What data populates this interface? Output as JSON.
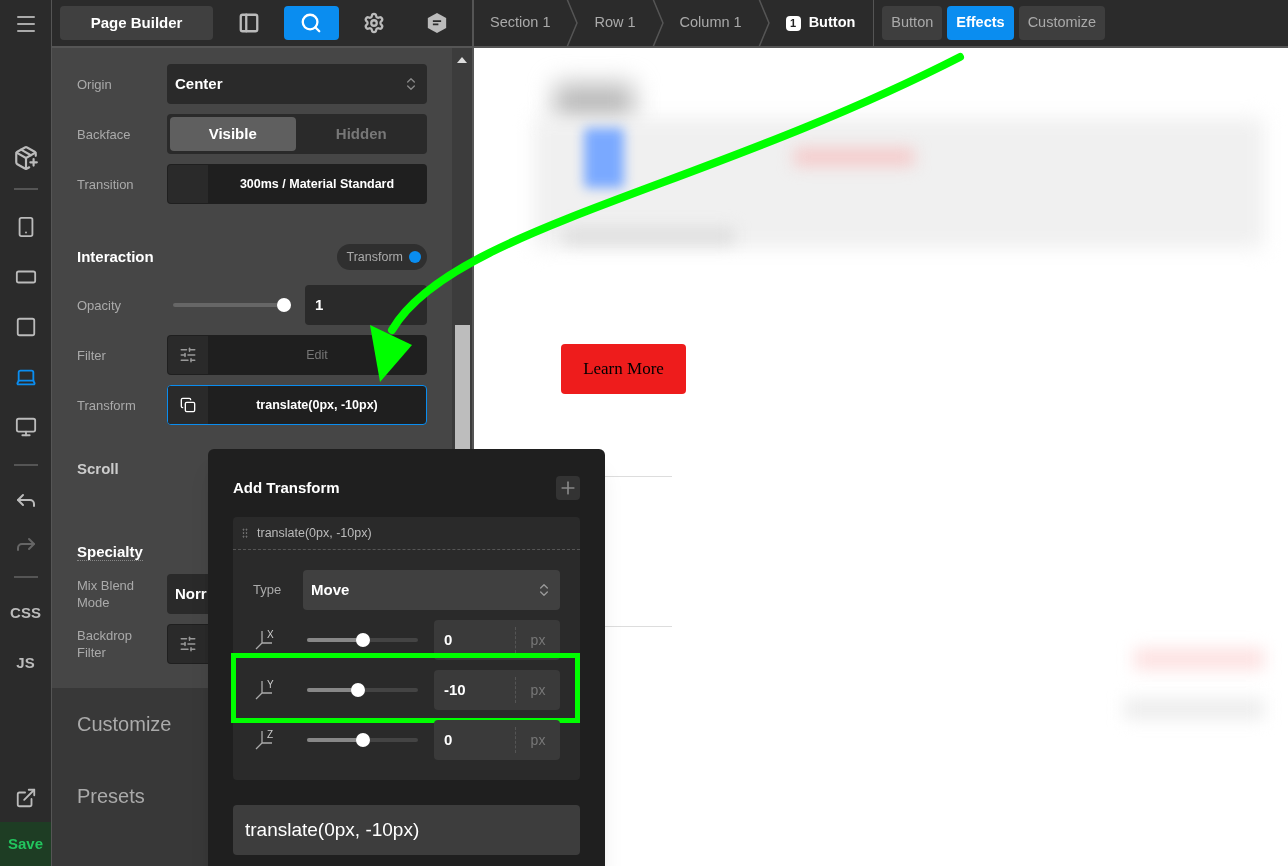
{
  "rail": {
    "devices": [
      {
        "selected": false
      },
      {
        "selected": false
      },
      {
        "selected": false
      },
      {
        "selected": true
      },
      {
        "selected": false
      }
    ],
    "code_buttons": [
      "CSS",
      "JS"
    ],
    "save": "Save"
  },
  "header": {
    "title": "Page Builder",
    "tools": [
      {
        "selected": false
      },
      {
        "selected": true
      },
      {
        "selected": false
      },
      {
        "selected": false
      }
    ]
  },
  "breadcrumbs": [
    {
      "label": "Section 1",
      "current": false
    },
    {
      "label": "Row 1",
      "current": false
    },
    {
      "label": "Column 1",
      "current": false
    },
    {
      "label": "Button",
      "badge": "1",
      "current": true
    }
  ],
  "tabs": [
    {
      "label": "Button",
      "selected": false
    },
    {
      "label": "Effects",
      "selected": true
    },
    {
      "label": "Customize",
      "selected": false
    }
  ],
  "panel": {
    "rows": [
      {
        "kind": "select",
        "label": "Origin",
        "value": "Center"
      },
      {
        "kind": "segmented",
        "label": "Backface",
        "options": [
          {
            "label": "Visible",
            "selected": true
          },
          {
            "label": "Hidden",
            "selected": false
          }
        ]
      },
      {
        "kind": "transition",
        "label": "Transition",
        "value": "300ms / Material Standard",
        "set": true,
        "focused": false
      }
    ],
    "interaction": {
      "title": "Interaction",
      "toggle": {
        "label": "Transform",
        "on": true
      },
      "rows": [
        {
          "kind": "slider",
          "label": "Opacity",
          "level": 1,
          "value": "1"
        },
        {
          "kind": "filter",
          "label": "Filter",
          "placeholder": "Edit",
          "focused": false
        },
        {
          "kind": "transform",
          "label": "Transform",
          "value": "translate(0px, -10px)",
          "set": true,
          "focused": true
        }
      ]
    },
    "scroll": {
      "title": "Scroll"
    },
    "specialty": {
      "title": "Specialty",
      "rows": [
        {
          "kind": "select",
          "label": "Mix Blend Mode",
          "value": "Norr"
        },
        {
          "kind": "filter",
          "label": "Backdrop Filter",
          "focused": false
        }
      ]
    },
    "sections": [
      "Customize",
      "Presets"
    ]
  },
  "popover": {
    "title": "Add Transform",
    "item": {
      "label": "translate(0px, -10px)",
      "type_label": "Type",
      "type_value": "Move",
      "axes": [
        {
          "axis": "X",
          "level": 0.5,
          "value": "0",
          "unit": "px",
          "highlighted": false
        },
        {
          "axis": "Y",
          "level": 0.45,
          "value": "-10",
          "unit": "px",
          "highlighted": true
        },
        {
          "axis": "Z",
          "level": 0.5,
          "value": "0",
          "unit": "px",
          "highlighted": false
        }
      ]
    },
    "output": "translate(0px, -10px)"
  },
  "canvas": {
    "button": "Learn More"
  }
}
